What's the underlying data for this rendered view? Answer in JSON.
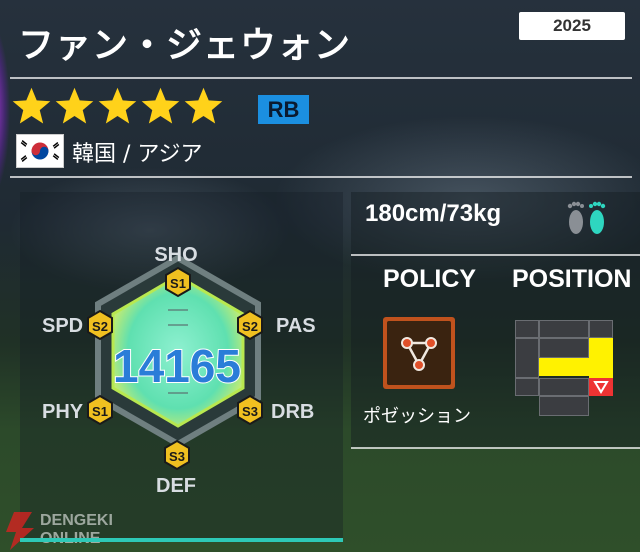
{
  "player": {
    "name": "ファン・ジェウォン",
    "season": "2025",
    "stars": 5,
    "position": "RB",
    "nationality": "韓国 / アジア",
    "body": "180cm/73kg",
    "overall": "14165"
  },
  "stats": {
    "sho": {
      "label": "SHO",
      "grade": "S1"
    },
    "pas": {
      "label": "PAS",
      "grade": "S2"
    },
    "drb": {
      "label": "DRB",
      "grade": "S3"
    },
    "def": {
      "label": "DEF",
      "grade": "S3"
    },
    "phy": {
      "label": "PHY",
      "grade": "S1"
    },
    "spd": {
      "label": "SPD",
      "grade": "S2"
    }
  },
  "headings": {
    "policy": "POLICY",
    "position": "POSITION"
  },
  "policy": {
    "label": "ポゼッション",
    "icon": "possession-triangle-icon"
  },
  "position_map": {
    "highlighted": [
      "RB"
    ],
    "marker_icon": "red-triangle-marker-icon"
  },
  "watermark": {
    "line1": "DENGEKI",
    "line2": "ONLINE"
  },
  "colors": {
    "star": "#ffd21a",
    "position_badge": "#1b8fe0",
    "hexagon": "#6ee3b5",
    "grade_badge": "#f0c020",
    "highlight": "#fff200",
    "accent_bar": "#2ec9b7"
  }
}
